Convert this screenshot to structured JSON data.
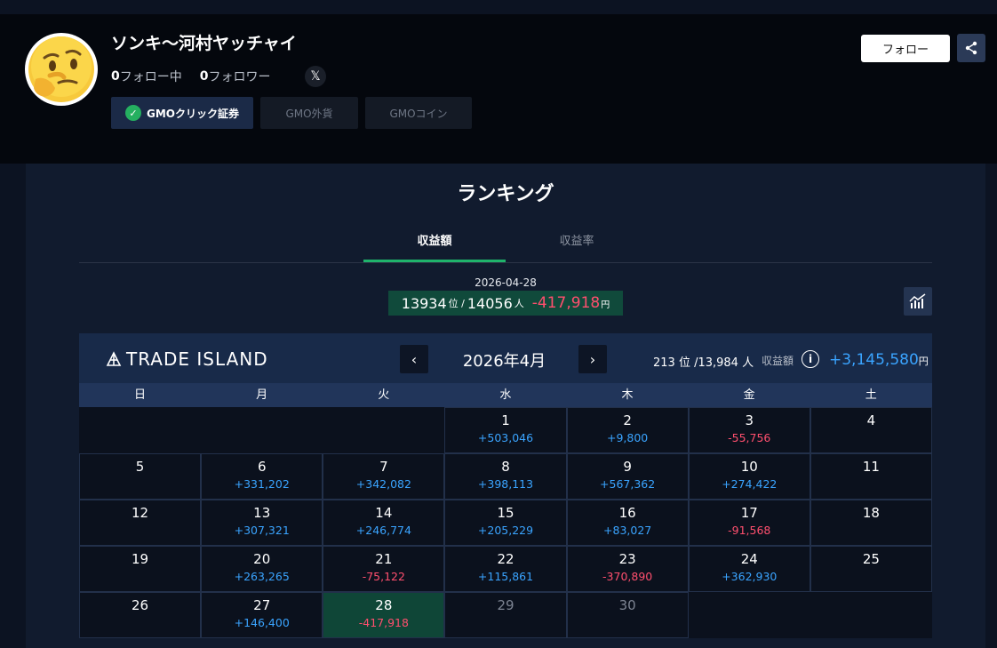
{
  "profile": {
    "name": "ソンキ〜河村ヤッチャイ",
    "following_count": "0",
    "following_label": "フォロー中",
    "followers_count": "0",
    "followers_label": "フォロワー",
    "follow_button": "フォロー",
    "chips": [
      "GMOクリック証券",
      "GMO外貨",
      "GMOコイン"
    ]
  },
  "ranking": {
    "title": "ランキング",
    "tabs": [
      "収益額",
      "収益率"
    ],
    "active_tab": "収益額",
    "date": "2026-04-28",
    "rank": "13934",
    "rank_unit": "位 /",
    "total": "14056",
    "total_unit": "人",
    "pl": "-417,918",
    "yen": "円"
  },
  "calendar": {
    "logo_text": "TRADE ISLAND",
    "month": "2026年4月",
    "month_rank": "213 位 /13,984 人",
    "pl_label": "収益額",
    "month_pl": "+3,145,580",
    "yen": "円",
    "weekdays": [
      "日",
      "月",
      "火",
      "水",
      "木",
      "金",
      "土"
    ],
    "cells": [
      {
        "d": "",
        "v": ""
      },
      {
        "d": "",
        "v": ""
      },
      {
        "d": "",
        "v": ""
      },
      {
        "d": "1",
        "v": "+503,046"
      },
      {
        "d": "2",
        "v": "+9,800"
      },
      {
        "d": "3",
        "v": "-55,756"
      },
      {
        "d": "4",
        "v": ""
      },
      {
        "d": "5",
        "v": ""
      },
      {
        "d": "6",
        "v": "+331,202"
      },
      {
        "d": "7",
        "v": "+342,082"
      },
      {
        "d": "8",
        "v": "+398,113"
      },
      {
        "d": "9",
        "v": "+567,362"
      },
      {
        "d": "10",
        "v": "+274,422"
      },
      {
        "d": "11",
        "v": ""
      },
      {
        "d": "12",
        "v": ""
      },
      {
        "d": "13",
        "v": "+307,321"
      },
      {
        "d": "14",
        "v": "+246,774"
      },
      {
        "d": "15",
        "v": "+205,229"
      },
      {
        "d": "16",
        "v": "+83,027"
      },
      {
        "d": "17",
        "v": "-91,568"
      },
      {
        "d": "18",
        "v": ""
      },
      {
        "d": "19",
        "v": ""
      },
      {
        "d": "20",
        "v": "+263,265"
      },
      {
        "d": "21",
        "v": "-75,122"
      },
      {
        "d": "22",
        "v": "+115,861"
      },
      {
        "d": "23",
        "v": "-370,890"
      },
      {
        "d": "24",
        "v": "+362,930"
      },
      {
        "d": "25",
        "v": ""
      },
      {
        "d": "26",
        "v": ""
      },
      {
        "d": "27",
        "v": "+146,400"
      },
      {
        "d": "28",
        "v": "-417,918",
        "today": true
      },
      {
        "d": "29",
        "v": "",
        "future": true
      },
      {
        "d": "30",
        "v": "",
        "future": true
      },
      {
        "d": "",
        "v": ""
      },
      {
        "d": "",
        "v": ""
      }
    ]
  },
  "colors": {
    "positive": "#3aa4ff",
    "negative": "#ff4f6e",
    "accent_green": "#1fb36b",
    "today_bg": "#0f4637"
  }
}
